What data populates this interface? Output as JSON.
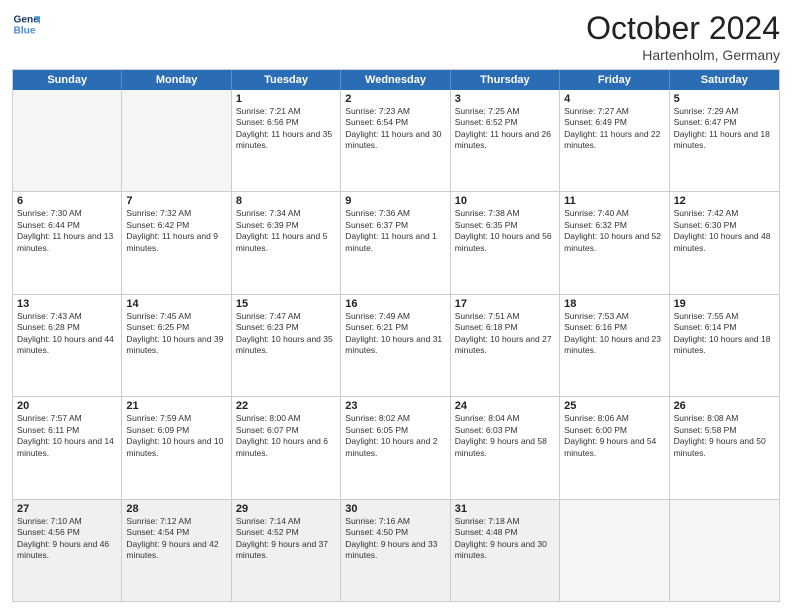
{
  "logo": {
    "line1": "General",
    "line2": "Blue"
  },
  "title": "October 2024",
  "location": "Hartenholm, Germany",
  "days": [
    "Sunday",
    "Monday",
    "Tuesday",
    "Wednesday",
    "Thursday",
    "Friday",
    "Saturday"
  ],
  "weeks": [
    [
      {
        "day": "",
        "sunrise": "",
        "sunset": "",
        "daylight": "",
        "empty": true
      },
      {
        "day": "",
        "sunrise": "",
        "sunset": "",
        "daylight": "",
        "empty": true
      },
      {
        "day": "1",
        "sunrise": "Sunrise: 7:21 AM",
        "sunset": "Sunset: 6:56 PM",
        "daylight": "Daylight: 11 hours and 35 minutes.",
        "empty": false
      },
      {
        "day": "2",
        "sunrise": "Sunrise: 7:23 AM",
        "sunset": "Sunset: 6:54 PM",
        "daylight": "Daylight: 11 hours and 30 minutes.",
        "empty": false
      },
      {
        "day": "3",
        "sunrise": "Sunrise: 7:25 AM",
        "sunset": "Sunset: 6:52 PM",
        "daylight": "Daylight: 11 hours and 26 minutes.",
        "empty": false
      },
      {
        "day": "4",
        "sunrise": "Sunrise: 7:27 AM",
        "sunset": "Sunset: 6:49 PM",
        "daylight": "Daylight: 11 hours and 22 minutes.",
        "empty": false
      },
      {
        "day": "5",
        "sunrise": "Sunrise: 7:29 AM",
        "sunset": "Sunset: 6:47 PM",
        "daylight": "Daylight: 11 hours and 18 minutes.",
        "empty": false
      }
    ],
    [
      {
        "day": "6",
        "sunrise": "Sunrise: 7:30 AM",
        "sunset": "Sunset: 6:44 PM",
        "daylight": "Daylight: 11 hours and 13 minutes.",
        "empty": false
      },
      {
        "day": "7",
        "sunrise": "Sunrise: 7:32 AM",
        "sunset": "Sunset: 6:42 PM",
        "daylight": "Daylight: 11 hours and 9 minutes.",
        "empty": false
      },
      {
        "day": "8",
        "sunrise": "Sunrise: 7:34 AM",
        "sunset": "Sunset: 6:39 PM",
        "daylight": "Daylight: 11 hours and 5 minutes.",
        "empty": false
      },
      {
        "day": "9",
        "sunrise": "Sunrise: 7:36 AM",
        "sunset": "Sunset: 6:37 PM",
        "daylight": "Daylight: 11 hours and 1 minute.",
        "empty": false
      },
      {
        "day": "10",
        "sunrise": "Sunrise: 7:38 AM",
        "sunset": "Sunset: 6:35 PM",
        "daylight": "Daylight: 10 hours and 56 minutes.",
        "empty": false
      },
      {
        "day": "11",
        "sunrise": "Sunrise: 7:40 AM",
        "sunset": "Sunset: 6:32 PM",
        "daylight": "Daylight: 10 hours and 52 minutes.",
        "empty": false
      },
      {
        "day": "12",
        "sunrise": "Sunrise: 7:42 AM",
        "sunset": "Sunset: 6:30 PM",
        "daylight": "Daylight: 10 hours and 48 minutes.",
        "empty": false
      }
    ],
    [
      {
        "day": "13",
        "sunrise": "Sunrise: 7:43 AM",
        "sunset": "Sunset: 6:28 PM",
        "daylight": "Daylight: 10 hours and 44 minutes.",
        "empty": false
      },
      {
        "day": "14",
        "sunrise": "Sunrise: 7:45 AM",
        "sunset": "Sunset: 6:25 PM",
        "daylight": "Daylight: 10 hours and 39 minutes.",
        "empty": false
      },
      {
        "day": "15",
        "sunrise": "Sunrise: 7:47 AM",
        "sunset": "Sunset: 6:23 PM",
        "daylight": "Daylight: 10 hours and 35 minutes.",
        "empty": false
      },
      {
        "day": "16",
        "sunrise": "Sunrise: 7:49 AM",
        "sunset": "Sunset: 6:21 PM",
        "daylight": "Daylight: 10 hours and 31 minutes.",
        "empty": false
      },
      {
        "day": "17",
        "sunrise": "Sunrise: 7:51 AM",
        "sunset": "Sunset: 6:18 PM",
        "daylight": "Daylight: 10 hours and 27 minutes.",
        "empty": false
      },
      {
        "day": "18",
        "sunrise": "Sunrise: 7:53 AM",
        "sunset": "Sunset: 6:16 PM",
        "daylight": "Daylight: 10 hours and 23 minutes.",
        "empty": false
      },
      {
        "day": "19",
        "sunrise": "Sunrise: 7:55 AM",
        "sunset": "Sunset: 6:14 PM",
        "daylight": "Daylight: 10 hours and 18 minutes.",
        "empty": false
      }
    ],
    [
      {
        "day": "20",
        "sunrise": "Sunrise: 7:57 AM",
        "sunset": "Sunset: 6:11 PM",
        "daylight": "Daylight: 10 hours and 14 minutes.",
        "empty": false
      },
      {
        "day": "21",
        "sunrise": "Sunrise: 7:59 AM",
        "sunset": "Sunset: 6:09 PM",
        "daylight": "Daylight: 10 hours and 10 minutes.",
        "empty": false
      },
      {
        "day": "22",
        "sunrise": "Sunrise: 8:00 AM",
        "sunset": "Sunset: 6:07 PM",
        "daylight": "Daylight: 10 hours and 6 minutes.",
        "empty": false
      },
      {
        "day": "23",
        "sunrise": "Sunrise: 8:02 AM",
        "sunset": "Sunset: 6:05 PM",
        "daylight": "Daylight: 10 hours and 2 minutes.",
        "empty": false
      },
      {
        "day": "24",
        "sunrise": "Sunrise: 8:04 AM",
        "sunset": "Sunset: 6:03 PM",
        "daylight": "Daylight: 9 hours and 58 minutes.",
        "empty": false
      },
      {
        "day": "25",
        "sunrise": "Sunrise: 8:06 AM",
        "sunset": "Sunset: 6:00 PM",
        "daylight": "Daylight: 9 hours and 54 minutes.",
        "empty": false
      },
      {
        "day": "26",
        "sunrise": "Sunrise: 8:08 AM",
        "sunset": "Sunset: 5:58 PM",
        "daylight": "Daylight: 9 hours and 50 minutes.",
        "empty": false
      }
    ],
    [
      {
        "day": "27",
        "sunrise": "Sunrise: 7:10 AM",
        "sunset": "Sunset: 4:56 PM",
        "daylight": "Daylight: 9 hours and 46 minutes.",
        "empty": false
      },
      {
        "day": "28",
        "sunrise": "Sunrise: 7:12 AM",
        "sunset": "Sunset: 4:54 PM",
        "daylight": "Daylight: 9 hours and 42 minutes.",
        "empty": false
      },
      {
        "day": "29",
        "sunrise": "Sunrise: 7:14 AM",
        "sunset": "Sunset: 4:52 PM",
        "daylight": "Daylight: 9 hours and 37 minutes.",
        "empty": false
      },
      {
        "day": "30",
        "sunrise": "Sunrise: 7:16 AM",
        "sunset": "Sunset: 4:50 PM",
        "daylight": "Daylight: 9 hours and 33 minutes.",
        "empty": false
      },
      {
        "day": "31",
        "sunrise": "Sunrise: 7:18 AM",
        "sunset": "Sunset: 4:48 PM",
        "daylight": "Daylight: 9 hours and 30 minutes.",
        "empty": false
      },
      {
        "day": "",
        "sunrise": "",
        "sunset": "",
        "daylight": "",
        "empty": true
      },
      {
        "day": "",
        "sunrise": "",
        "sunset": "",
        "daylight": "",
        "empty": true
      }
    ]
  ]
}
